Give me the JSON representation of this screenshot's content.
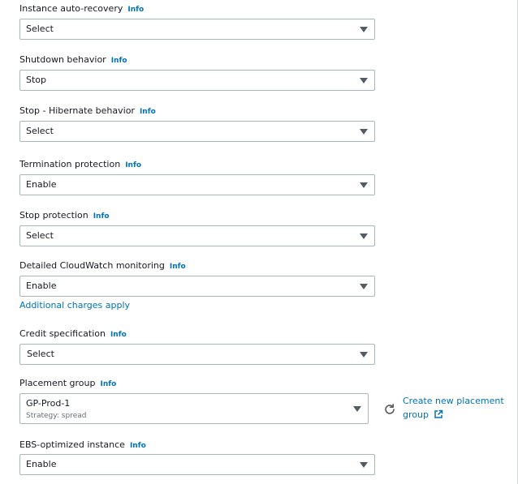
{
  "fields": {
    "auto_recovery": {
      "label": "Instance auto-recovery",
      "info": "Info",
      "value": "Select"
    },
    "shutdown": {
      "label": "Shutdown behavior",
      "info": "Info",
      "value": "Stop"
    },
    "hibernate": {
      "label": "Stop - Hibernate behavior",
      "info": "Info",
      "value": "Select"
    },
    "termination": {
      "label": "Termination protection",
      "info": "Info",
      "value": "Enable"
    },
    "stop_protection": {
      "label": "Stop protection",
      "info": "Info",
      "value": "Select"
    },
    "cloudwatch": {
      "label": "Detailed CloudWatch monitoring",
      "info": "Info",
      "value": "Enable",
      "note": "Additional charges apply"
    },
    "credit": {
      "label": "Credit specification",
      "info": "Info",
      "value": "Select"
    },
    "placement": {
      "label": "Placement group",
      "info": "Info",
      "value": "GP-Prod-1",
      "sub": "Strategy: spread",
      "create_line1": "Create new placement",
      "create_line2": "group"
    },
    "ebs": {
      "label": "EBS-optimized instance",
      "info": "Info",
      "value": "Enable"
    }
  },
  "icons": {
    "caret": "chevron-down-icon",
    "refresh": "refresh-icon",
    "external": "external-link-icon"
  },
  "colors": {
    "link": "#0073bb",
    "border": "#aab7b8",
    "text": "#16191f",
    "caret": "#545b64"
  }
}
